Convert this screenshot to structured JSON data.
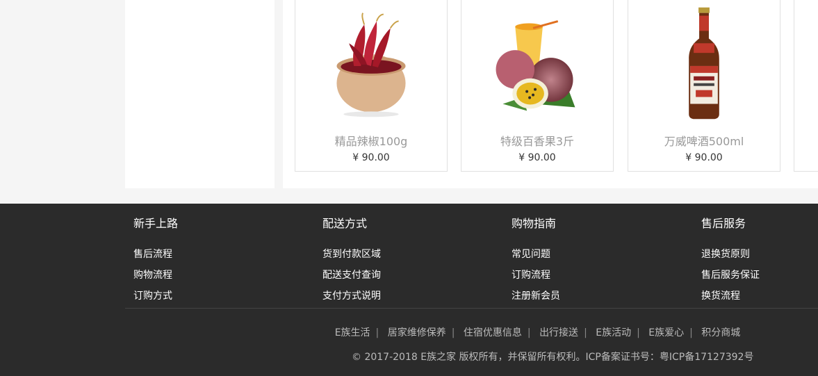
{
  "products": [
    {
      "name": "精品辣椒100g",
      "price": "¥ 90.00",
      "image": "dried-chili-bowl"
    },
    {
      "name": "特级百香果3斤",
      "price": "¥ 90.00",
      "image": "passion-fruit-drink"
    },
    {
      "name": "万威啤酒500ml",
      "price": "¥ 90.00",
      "image": "beer-bottle"
    }
  ],
  "footer": {
    "columns": [
      {
        "title": "新手上路",
        "links": [
          "售后流程",
          "购物流程",
          "订购方式"
        ]
      },
      {
        "title": "配送方式",
        "links": [
          "货到付款区域",
          "配送支付查询",
          "支付方式说明"
        ]
      },
      {
        "title": "购物指南",
        "links": [
          "常见问题",
          "订购流程",
          "注册新会员"
        ]
      },
      {
        "title": "售后服务",
        "links": [
          "退换货原则",
          "售后服务保证",
          "换货流程"
        ]
      }
    ],
    "bottom_links": [
      "E族生活",
      "居家维修保养",
      "住宿优惠信息",
      "出行接送",
      "E族活动",
      "E族爱心",
      "积分商城"
    ],
    "copyright": "© 2017-2018  E族之家  版权所有，并保留所有权利。ICP备案证书号：粤ICP备17127392号"
  },
  "colors": {
    "footer_bg": "#2b2b2b",
    "page_bg": "#f5f5f5"
  }
}
